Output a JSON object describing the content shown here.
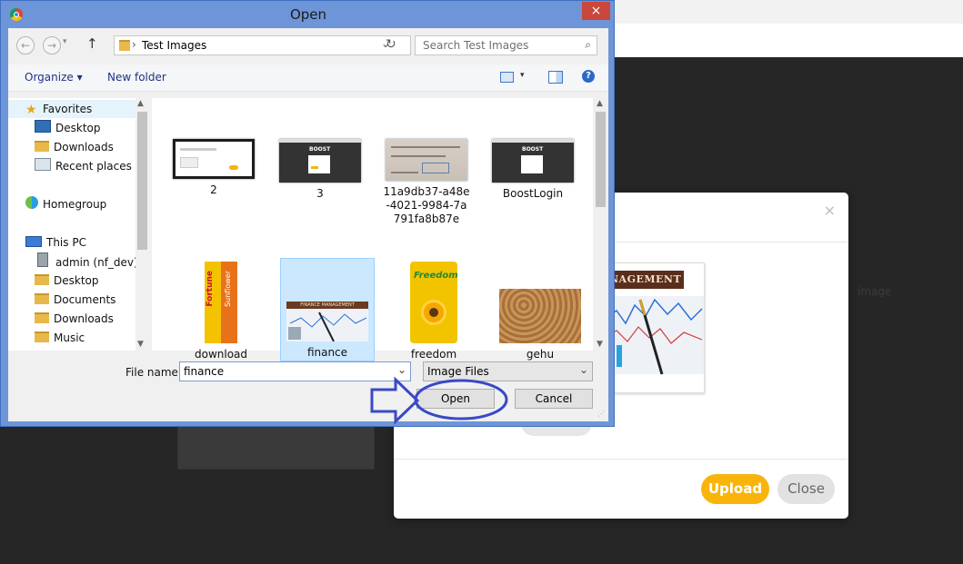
{
  "dialog": {
    "title": "Open",
    "close_symbol": "×",
    "nav": {
      "back": "←",
      "forward": "→",
      "up": "↑"
    },
    "address": {
      "arrow": "›",
      "path": "Test Images"
    },
    "search_placeholder": "Search Test Images",
    "toolbar": {
      "organize": "Organize ▾",
      "new_folder": "New folder"
    },
    "nav_items": [
      {
        "label": "Favorites",
        "icon": "star-icon"
      },
      {
        "label": "Desktop",
        "icon": "desktop-icon"
      },
      {
        "label": "Downloads",
        "icon": "folder-icon"
      },
      {
        "label": "Recent places",
        "icon": "recent-places-icon"
      },
      {
        "label": "Homegroup",
        "icon": "homegroup-icon"
      },
      {
        "label": "This PC",
        "icon": "computer-icon"
      },
      {
        "label": "admin (nf_dev)",
        "icon": "network-drive-icon"
      },
      {
        "label": "Desktop",
        "icon": "folder-icon"
      },
      {
        "label": "Documents",
        "icon": "folder-icon"
      },
      {
        "label": "Downloads",
        "icon": "folder-icon"
      },
      {
        "label": "Music",
        "icon": "folder-icon"
      }
    ],
    "files": [
      {
        "name": "2"
      },
      {
        "name": "3"
      },
      {
        "name": "11a9db37-a48e-4021-9984-7a791fa8b87e"
      },
      {
        "name": "BoostLogin"
      },
      {
        "name": "download"
      },
      {
        "name": "finance",
        "selected": true
      },
      {
        "name": "freedom"
      },
      {
        "name": "gehu"
      }
    ],
    "file_name_label": "File name:",
    "file_name_value": "finance",
    "file_type": "Image Files",
    "open_label": "Open",
    "cancel_label": "Cancel",
    "thumb_text": {
      "boost": "BOOST",
      "finance": "FINANCE MANAGEMENT",
      "sunflower": "Sunflower",
      "fortune": "Fortune",
      "freedom": "Freedom"
    }
  },
  "upload_modal": {
    "close_symbol": "×",
    "preview_caption": "NAGEMENT",
    "upload_label": "Upload",
    "close_label": "Close",
    "side_text": "image"
  },
  "colors": {
    "accent": "#f9b40c",
    "annotation": "#3a48c8",
    "selection": "#cce8ff"
  }
}
